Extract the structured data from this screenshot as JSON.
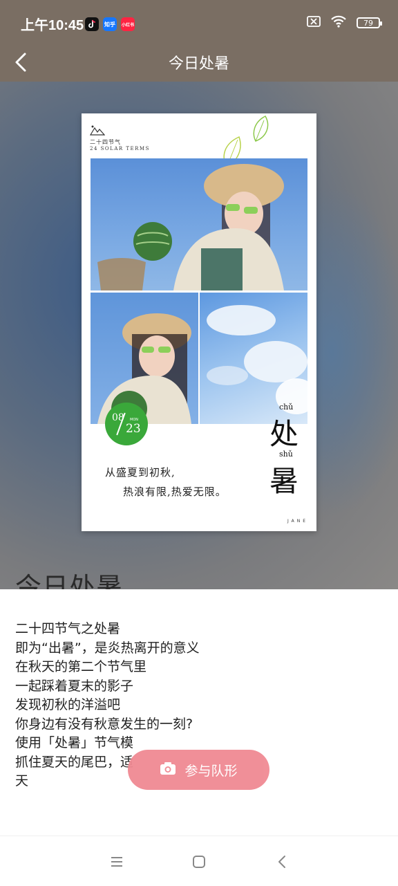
{
  "status_bar": {
    "time": "上午10:45",
    "app_icons": [
      {
        "name": "douyin-icon",
        "label": "",
        "color": "#111111"
      },
      {
        "name": "zhihu-icon",
        "label": "知乎",
        "color": "#1677ff"
      },
      {
        "name": "xiaohongshu-icon",
        "label": "小红书",
        "color": "#ff2442"
      }
    ],
    "battery": "79",
    "sim_icon": "no-sim-icon",
    "wifi_icon": "wifi-icon"
  },
  "header": {
    "title": "今日处暑",
    "back_icon": "back-arrow-icon"
  },
  "hero": {
    "big_title": "今日处暑"
  },
  "poster": {
    "brand_cn": "二十四节气",
    "brand_en": "24 SOLAR TERMS",
    "date_month": "08",
    "date_day": "23",
    "date_weekday": "MON",
    "pinyin_1": "chǔ",
    "han_1": "处",
    "pinyin_2": "shǔ",
    "han_2": "暑",
    "verse_line_1": "从盛夏到初秋,",
    "verse_line_2": "热浪有限,热爱无限。",
    "signature": "JANE"
  },
  "article": {
    "lines": [
      "二十四节气之处暑",
      "即为“出暑”，是炎热离开的意义",
      "在秋天的第二个节气里",
      "一起踩着夏末的影子",
      "发现初秋的洋溢吧",
      "你身边有没有秋意发生的一刻?",
      "",
      "使用「处暑」节气模",
      "抓住夏天的尾巴，适",
      "天"
    ]
  },
  "join_button": {
    "label": "参与队形",
    "icon": "camera-icon",
    "color": "#f08a93"
  },
  "nav_bar": {
    "menu_icon": "menu-icon",
    "home_icon": "home-icon",
    "back_icon": "back-icon"
  }
}
